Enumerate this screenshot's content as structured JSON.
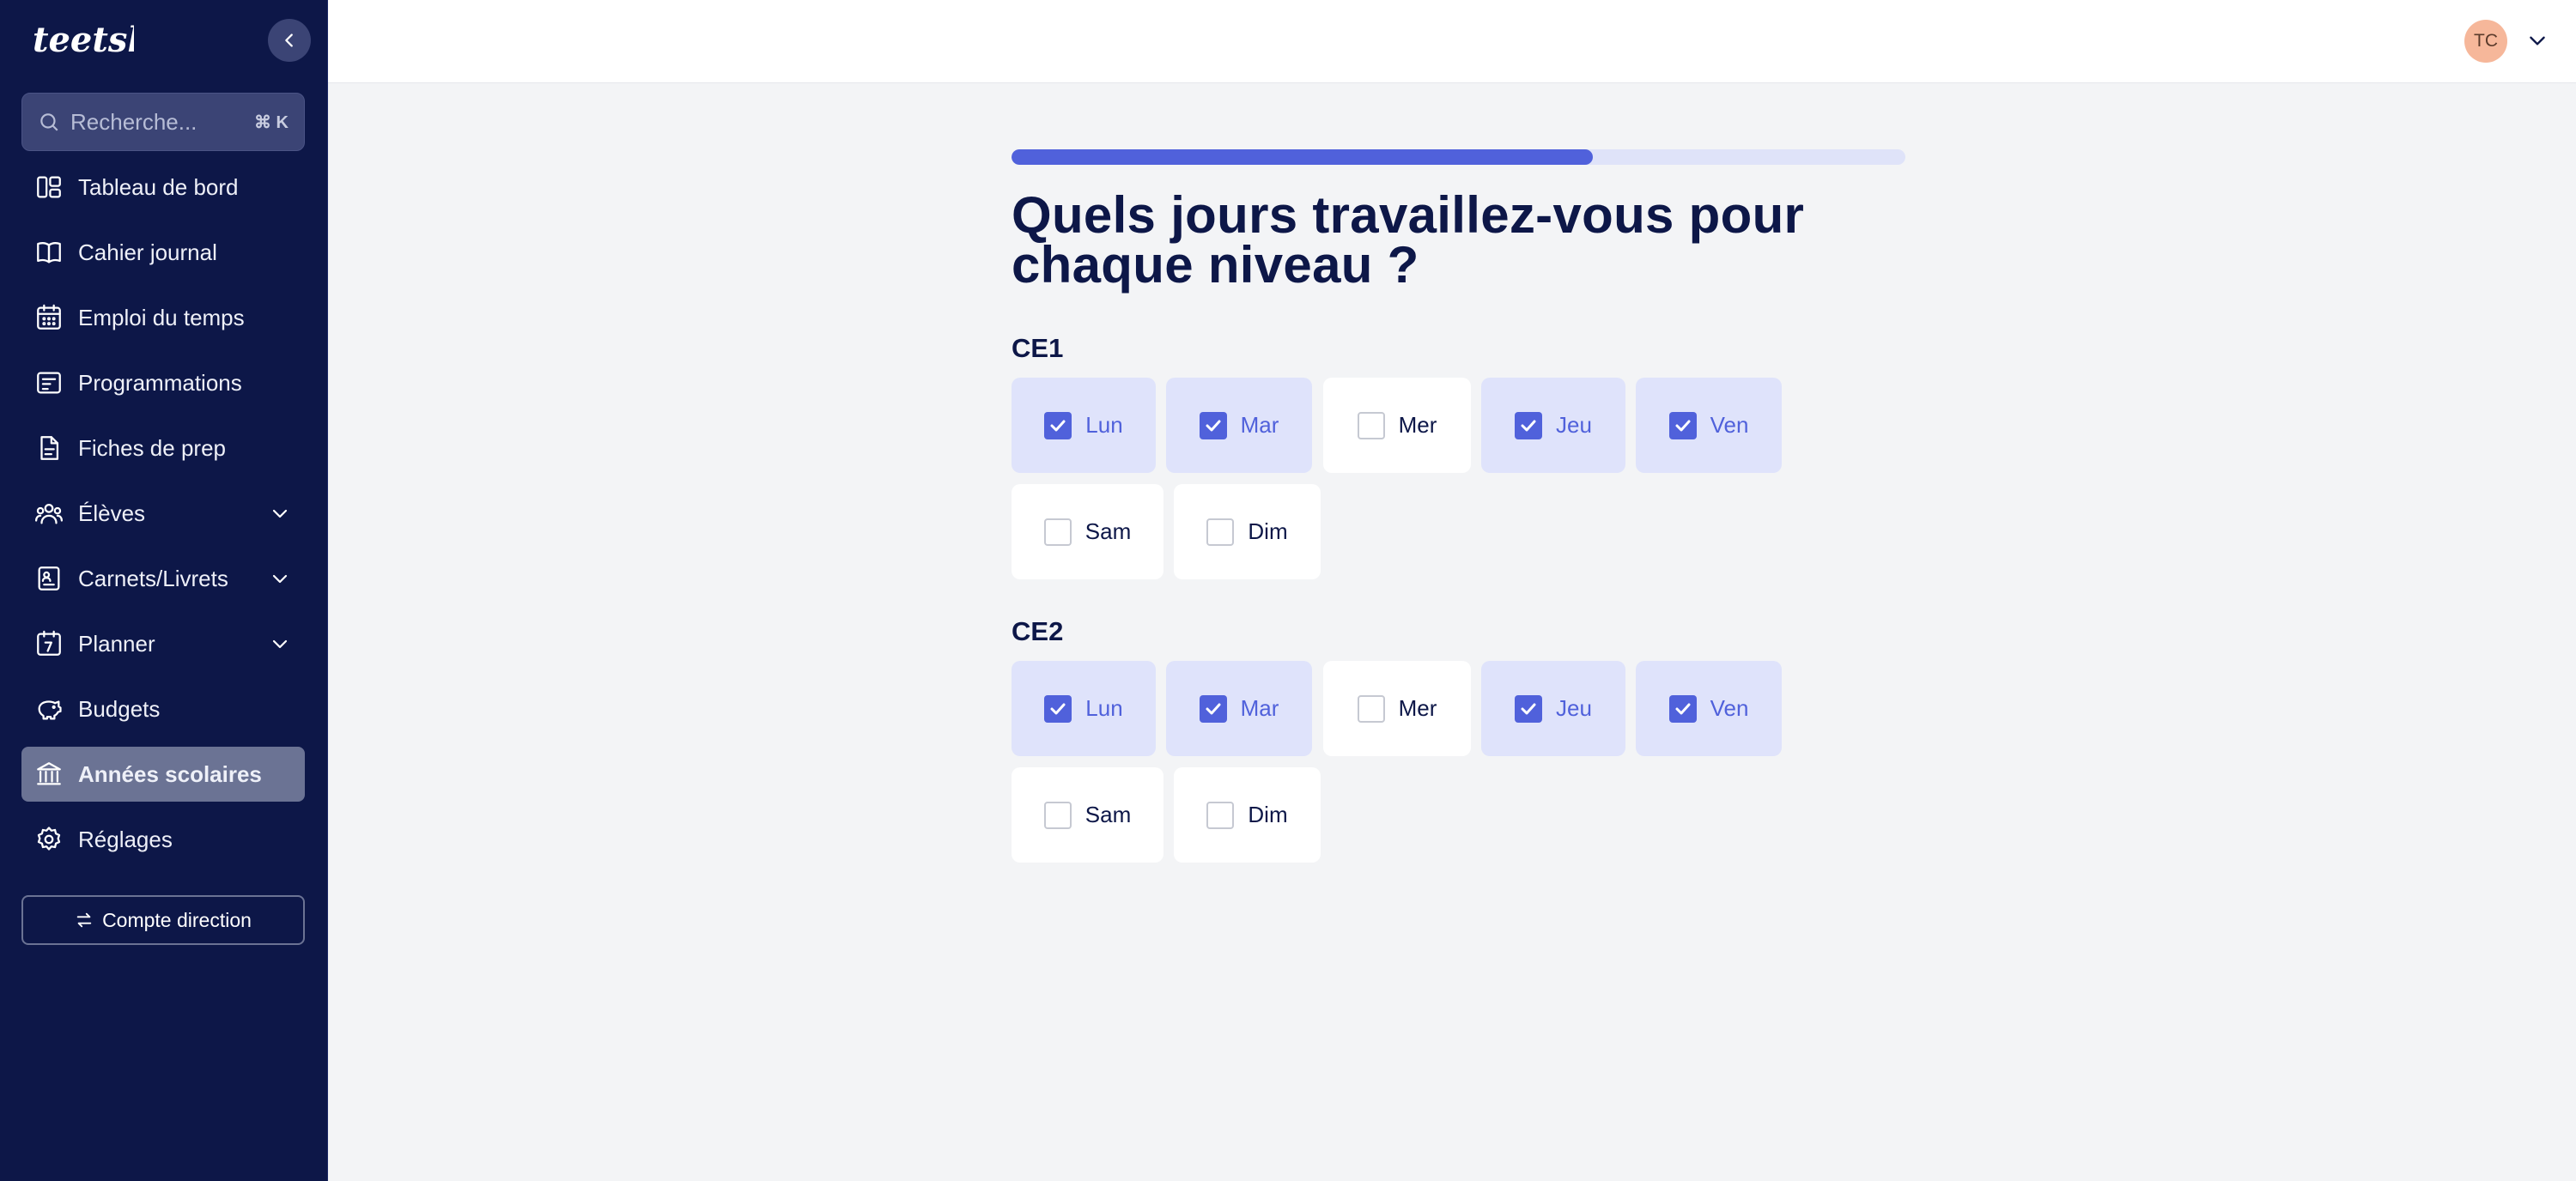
{
  "app": {
    "logo_text": "teetshi"
  },
  "search": {
    "placeholder": "Recherche...",
    "shortcut": "⌘ K"
  },
  "sidebar": {
    "items": [
      {
        "label": "Tableau de bord",
        "icon": "dashboard-icon",
        "expandable": false,
        "active": false
      },
      {
        "label": "Cahier journal",
        "icon": "book-icon",
        "expandable": false,
        "active": false
      },
      {
        "label": "Emploi du temps",
        "icon": "calendar-grid-icon",
        "expandable": false,
        "active": false
      },
      {
        "label": "Programmations",
        "icon": "program-icon",
        "expandable": false,
        "active": false
      },
      {
        "label": "Fiches de prep",
        "icon": "document-icon",
        "expandable": false,
        "active": false
      },
      {
        "label": "Élèves",
        "icon": "students-icon",
        "expandable": true,
        "active": false
      },
      {
        "label": "Carnets/Livrets",
        "icon": "notebook-icon",
        "expandable": true,
        "active": false
      },
      {
        "label": "Planner",
        "icon": "planner-icon",
        "expandable": true,
        "active": false
      },
      {
        "label": "Budgets",
        "icon": "piggy-bank-icon",
        "expandable": false,
        "active": false
      },
      {
        "label": "Années scolaires",
        "icon": "school-icon",
        "expandable": false,
        "active": true
      },
      {
        "label": "Réglages",
        "icon": "gear-icon",
        "expandable": false,
        "active": false
      }
    ],
    "direction_button": "Compte direction"
  },
  "header": {
    "avatar_initials": "TC"
  },
  "main": {
    "progress": 0.65,
    "title": "Quels jours travaillez-vous pour chaque niveau ?",
    "levels": [
      {
        "name": "CE1",
        "days": [
          {
            "label": "Lun",
            "checked": true
          },
          {
            "label": "Mar",
            "checked": true
          },
          {
            "label": "Mer",
            "checked": false
          },
          {
            "label": "Jeu",
            "checked": true
          },
          {
            "label": "Ven",
            "checked": true
          },
          {
            "label": "Sam",
            "checked": false
          },
          {
            "label": "Dim",
            "checked": false
          }
        ]
      },
      {
        "name": "CE2",
        "days": [
          {
            "label": "Lun",
            "checked": true
          },
          {
            "label": "Mar",
            "checked": true
          },
          {
            "label": "Mer",
            "checked": false
          },
          {
            "label": "Jeu",
            "checked": true
          },
          {
            "label": "Ven",
            "checked": true
          },
          {
            "label": "Sam",
            "checked": false
          },
          {
            "label": "Dim",
            "checked": false
          }
        ]
      }
    ]
  },
  "colors": {
    "sidebar_bg": "#0d1748",
    "accent": "#5061db",
    "checked_bg": "#dfe3fb",
    "active_nav": "#6b7394"
  }
}
